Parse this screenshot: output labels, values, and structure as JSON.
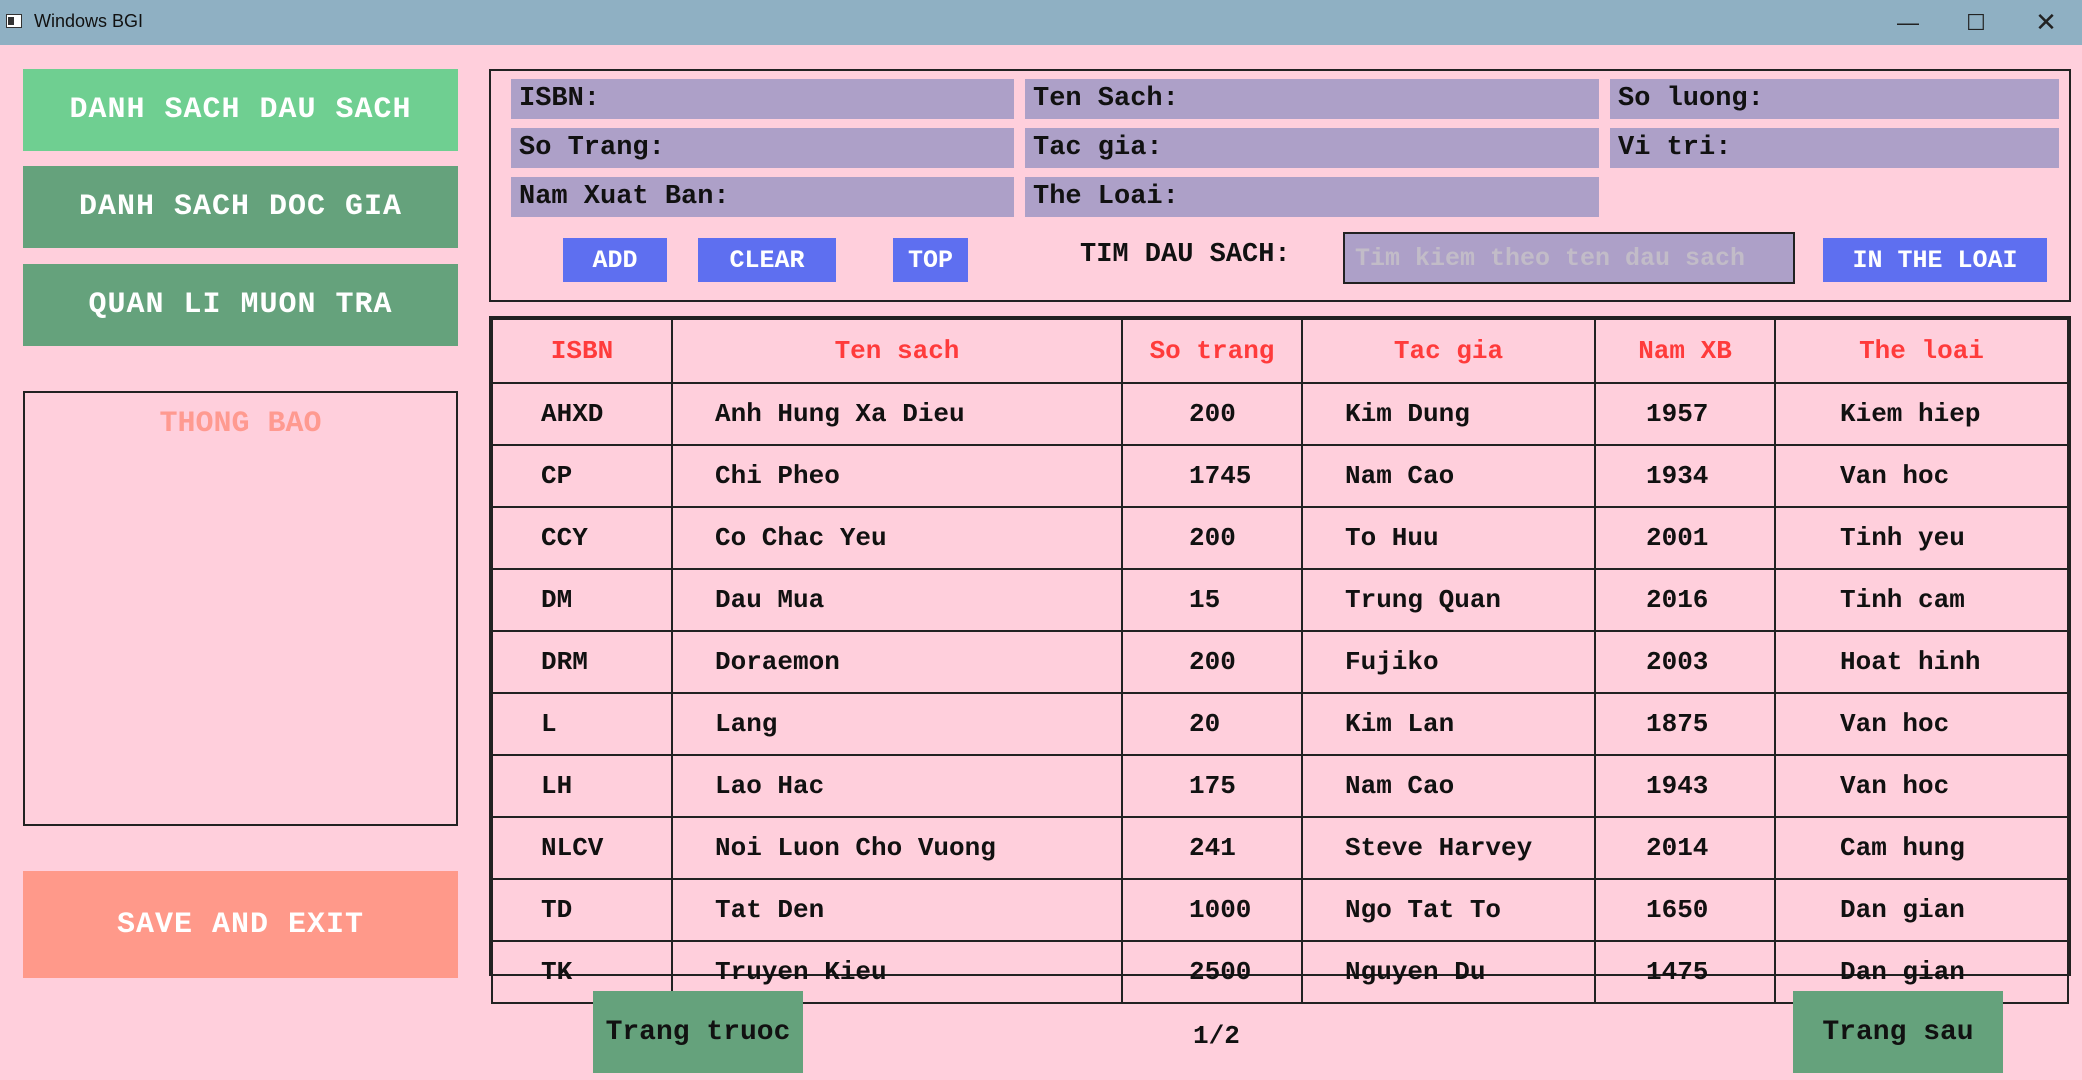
{
  "window": {
    "title": "Windows BGI",
    "min_glyph": "—",
    "max_glyph": "☐",
    "close_glyph": "✕"
  },
  "sidebar": {
    "buttons": [
      {
        "label": "DANH SACH DAU SACH",
        "color": "#6fcf91"
      },
      {
        "label": "DANH SACH DOC GIA",
        "color": "#65a27c"
      },
      {
        "label": "QUAN LI MUON TRA",
        "color": "#65a27c"
      }
    ],
    "notification_title": "THONG BAO",
    "save_exit_label": "SAVE AND EXIT",
    "save_exit_color": "#ff998a"
  },
  "form": {
    "isbn_label": "ISBN:",
    "ten_sach_label": "Ten Sach:",
    "so_luong_label": "So luong:",
    "so_trang_label": "So Trang:",
    "tac_gia_label": "Tac gia:",
    "vi_tri_label": "Vi tri:",
    "nam_xb_label": "Nam Xuat Ban:",
    "the_loai_label": "The Loai:",
    "add_label": "ADD",
    "clear_label": "CLEAR",
    "top_label": "TOP",
    "search_label": "TIM DAU SACH:",
    "search_placeholder": "Tim kiem theo ten dau sach",
    "in_the_loai_label": "IN THE LOAI"
  },
  "table": {
    "headers": [
      "ISBN",
      "Ten sach",
      "So trang",
      "Tac gia",
      "Nam XB",
      "The loai"
    ],
    "rows": [
      [
        "AHXD",
        "Anh Hung Xa Dieu",
        "200",
        "Kim Dung",
        "1957",
        "Kiem hiep"
      ],
      [
        "CP",
        "Chi Pheo",
        "1745",
        "Nam Cao",
        "1934",
        "Van hoc"
      ],
      [
        "CCY",
        "Co Chac Yeu",
        "200",
        "To Huu",
        "2001",
        "Tinh yeu"
      ],
      [
        "DM",
        "Dau Mua",
        "15",
        "Trung Quan",
        "2016",
        "Tinh cam"
      ],
      [
        "DRM",
        "Doraemon",
        "200",
        "Fujiko",
        "2003",
        "Hoat hinh"
      ],
      [
        "L",
        "Lang",
        "20",
        "Kim Lan",
        "1875",
        "Van hoc"
      ],
      [
        "LH",
        "Lao Hac",
        "175",
        "Nam Cao",
        "1943",
        "Van hoc"
      ],
      [
        "NLCV",
        "Noi Luon Cho Vuong",
        "241",
        "Steve Harvey",
        "2014",
        "Cam hung"
      ],
      [
        "TD",
        "Tat Den",
        "1000",
        "Ngo Tat To",
        "1650",
        "Dan gian"
      ],
      [
        "TK",
        "Truyen Kieu",
        "2500",
        "Nguyen Du",
        "1475",
        "Dan gian"
      ]
    ]
  },
  "pagination": {
    "prev_label": "Trang truoc",
    "next_label": "Trang sau",
    "page_text": "1/2"
  }
}
